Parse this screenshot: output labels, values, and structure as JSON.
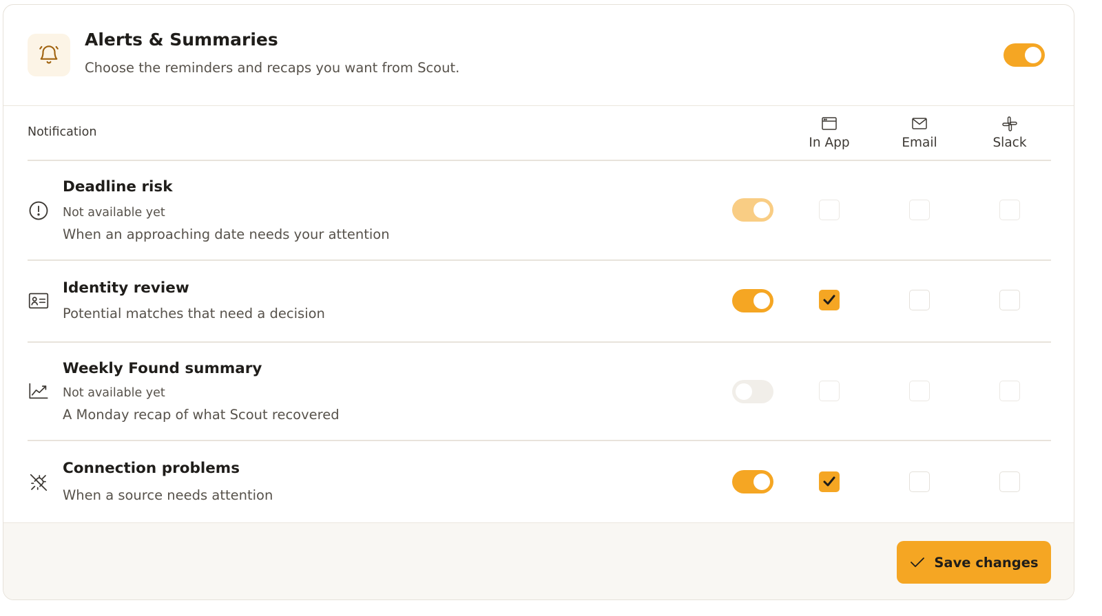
{
  "header": {
    "title": "Alerts & Summaries",
    "subtitle": "Choose the reminders and recaps you want from Scout.",
    "icon": "bell-icon",
    "master_enabled": true
  },
  "table": {
    "column_label": "Notification",
    "channels": [
      {
        "label": "In App",
        "icon": "app-window-icon"
      },
      {
        "label": "Email",
        "icon": "mail-icon"
      },
      {
        "label": "Slack",
        "icon": "slack-icon"
      }
    ]
  },
  "rows": [
    {
      "title": "Deadline risk",
      "note": "Not available yet",
      "description": "When an approaching date needs your attention",
      "icon": "alert-circle-icon",
      "enabled": true,
      "available": false,
      "in_app": false,
      "email": false,
      "slack": false
    },
    {
      "title": "Identity review",
      "description": "Potential matches that need a decision",
      "icon": "id-card-icon",
      "enabled": true,
      "available": true,
      "in_app": true,
      "email": false,
      "slack": false
    },
    {
      "title": "Weekly Found summary",
      "note": "Not available yet",
      "description": "A Monday recap of what Scout recovered",
      "icon": "trend-chart-icon",
      "enabled": false,
      "available": false,
      "in_app": false,
      "email": false,
      "slack": false
    },
    {
      "title": "Connection problems",
      "description": "When a source needs attention",
      "icon": "unplug-icon",
      "enabled": true,
      "available": true,
      "in_app": true,
      "email": false,
      "slack": false
    }
  ],
  "footer": {
    "save_label": "Save changes",
    "save_icon": "check-icon"
  },
  "colors": {
    "accent": "#f5a623",
    "accent_dim": "#f9cd84"
  }
}
